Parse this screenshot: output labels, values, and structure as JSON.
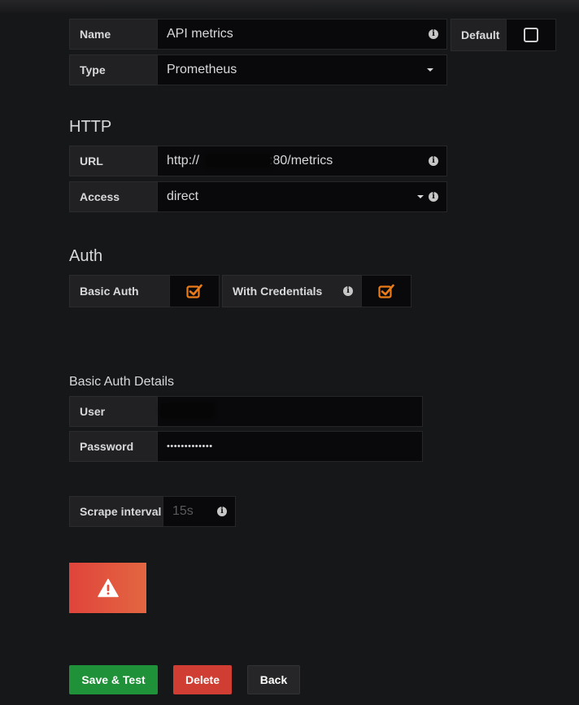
{
  "general": {
    "name_label": "Name",
    "name_value": "API metrics",
    "default_label": "Default",
    "type_label": "Type",
    "type_value": "Prometheus"
  },
  "http": {
    "title": "HTTP",
    "url_label": "URL",
    "url_prefix": "http://",
    "url_suffix": ":80/metrics",
    "access_label": "Access",
    "access_value": "direct"
  },
  "auth": {
    "title": "Auth",
    "basic_auth_label": "Basic Auth",
    "basic_auth_checked": true,
    "with_credentials_label": "With Credentials",
    "with_credentials_checked": true
  },
  "basic_auth_details": {
    "title": "Basic Auth Details",
    "user_label": "User",
    "password_label": "Password",
    "password_value": "•••••••••••••"
  },
  "scrape": {
    "label": "Scrape interval",
    "placeholder": "15s"
  },
  "buttons": {
    "save_test": "Save & Test",
    "delete": "Delete",
    "back": "Back"
  },
  "colors": {
    "background": "#161719",
    "accent_check": "#eb7b18",
    "save_button": "#1f9139",
    "delete_button": "#d03e33",
    "back_button": "#262628",
    "alert_gradient_start": "#e0443b",
    "alert_gradient_end": "#e36641"
  },
  "icons": {
    "info": "info-icon",
    "caret": "caret-down-icon",
    "checkbox_checked": "checkbox-checked-icon",
    "checkbox_empty": "checkbox-empty-icon",
    "warning": "warning-icon"
  }
}
